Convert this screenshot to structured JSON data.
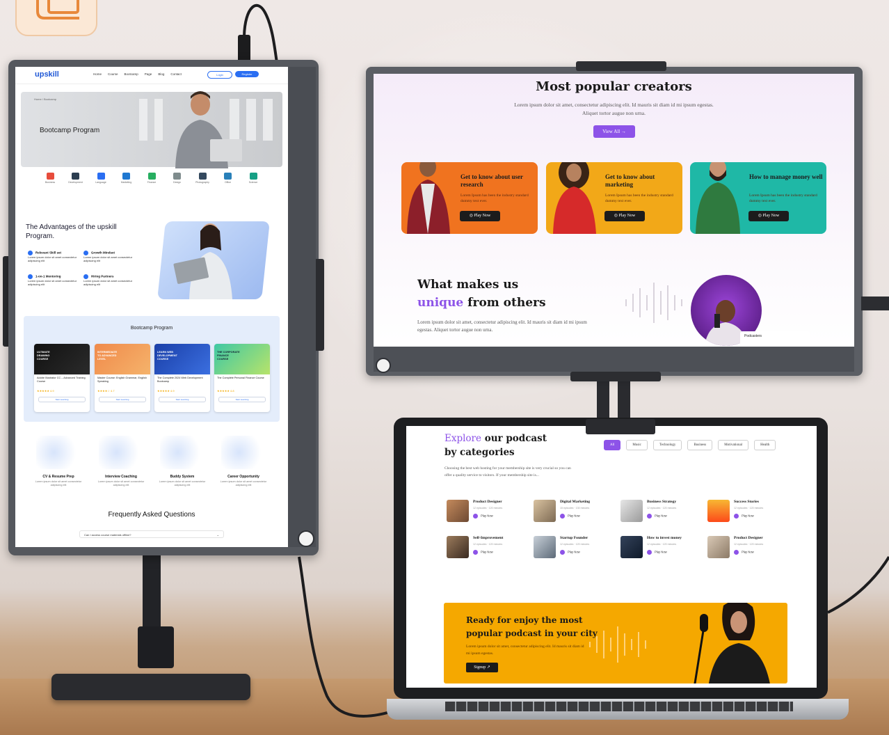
{
  "portrait": {
    "brand": "upskill",
    "nav": [
      "Home",
      "Course",
      "Bootcamp",
      "Page",
      "Blog",
      "Contact"
    ],
    "login": "Login",
    "register": "Register",
    "breadcrumb": "Home / Bootcamp",
    "hero_title": "Bootcamp Program",
    "categories": [
      "Business",
      "Development",
      "Language",
      "Marketing",
      "Finance",
      "Design",
      "Photography",
      "Office",
      "Science"
    ],
    "advantages_title": "The Advantages of the upskill Program.",
    "features": [
      {
        "title": "Relevant Skill set",
        "text": "Lorem ipsum dolor sit amet consectetur adipiscing elit"
      },
      {
        "title": "Growth Mindset",
        "text": "Lorem ipsum dolor sit amet consectetur adipiscing elit"
      },
      {
        "title": "1-on-1 Mentoring",
        "text": "Lorem ipsum dolor sit amet consectetur adipiscing elit"
      },
      {
        "title": "Hiring Partners",
        "text": "Lorem ipsum dolor sit amet consectetur adipiscing elit"
      }
    ],
    "bootcamp_title": "Bootcamp Program",
    "cards": [
      {
        "banner": "ULTIMATE DRAWING COURSE",
        "title": "Adobe Illustrator CC – Advanced Training Course",
        "rating": "★★★★★ 4.9",
        "cta": "Start Learning"
      },
      {
        "banner": "INTERMEDIATE TO ADVANCED LEVEL",
        "title": "Master Course: English Grammar, English Speaking",
        "rating": "★★★★☆ 4.7",
        "cta": "Start Learning"
      },
      {
        "banner": "LEARN WEB DEVELOPMENT COURSE",
        "title": "The Complete 2024 Web Development Bootcamp",
        "rating": "★★★★★ 4.9",
        "cta": "Start Learning"
      },
      {
        "banner": "THE CORPORATE FINANCE COURSE",
        "title": "The Complete Personal Finance Course",
        "rating": "★★★★★ 4.8",
        "cta": "Start Learning"
      }
    ],
    "services": [
      {
        "title": "CV & Resume Prep",
        "text": "Lorem ipsum dolor sit amet consectetur adipiscing elit"
      },
      {
        "title": "Interview Coaching",
        "text": "Lorem ipsum dolor sit amet consectetur adipiscing elit"
      },
      {
        "title": "Buddy System",
        "text": "Lorem ipsum dolor sit amet consectetur adipiscing elit"
      },
      {
        "title": "Career Opportunity",
        "text": "Lorem ipsum dolor sit amet consectetur adipiscing elit"
      }
    ],
    "faq_title": "Frequently Asked Questions",
    "faq_q1": "Can I access course materials offline?"
  },
  "landscape": {
    "title": "Most popular creators",
    "subtitle": "Lorem ipsum dolor sit amet, consectetur adipiscing elit. Id mauris sit diam id mi ipsum egestas. Aliquet tortor augue non urna.",
    "view_all": "View All →",
    "creators": [
      {
        "title": "Get to know about user research",
        "text": "Lorem Ipsum has been the industry standard dummy text ever.",
        "cta": "Play Now",
        "color": "#f0731f"
      },
      {
        "title": "Get to know about marketing",
        "text": "Lorem Ipsum has been the industry standard dummy text ever.",
        "cta": "Play Now",
        "color": "#f2a818"
      },
      {
        "title": "How to manage money well",
        "text": "Lorem Ipsum has been the industry standard dummy text ever.",
        "cta": "Play Now",
        "color": "#1fb8a6"
      }
    ],
    "what_1": "What makes us",
    "what_unique": "unique",
    "what_2": " from others",
    "what_text": "Lorem ipsum dolor sit amet, consectetur adipiscing elit. Id mauris sit diam id mi ipsum egestas. Aliquet tortor augue non urna.",
    "podcast_tag": "Podcasters"
  },
  "laptop": {
    "explore": "Explore",
    "title_rest": " our podcast",
    "title_line2": "by categories",
    "desc": "Choosing the best web hosting for your membership site is very crucial so you can offer a quality service to visitors. If your membership site is...",
    "chips": [
      "All",
      "Music",
      "Technology",
      "Business",
      "Motivational",
      "Health"
    ],
    "podcasts": [
      {
        "title": "Product Designer",
        "meta": "12 episodes · 120 minutes",
        "cta": "Play Now"
      },
      {
        "title": "Digital Marketing",
        "meta": "15 episodes · 130 minutes",
        "cta": "Play Now"
      },
      {
        "title": "Business Strategy",
        "meta": "12 episodes · 120 minutes",
        "cta": "Play Now"
      },
      {
        "title": "Success Stories",
        "meta": "12 episodes · 120 minutes",
        "cta": "Play Now"
      },
      {
        "title": "Self-Improvement",
        "meta": "12 episodes · 120 minutes",
        "cta": "Play Now"
      },
      {
        "title": "Startup Founder",
        "meta": "12 episodes · 120 minutes",
        "cta": "Play Now"
      },
      {
        "title": "How to invest money",
        "meta": "12 episodes · 120 minutes",
        "cta": "Play Now"
      },
      {
        "title": "Product Designer",
        "meta": "12 episodes · 120 minutes",
        "cta": "Play Now"
      }
    ],
    "banner_title_1": "Ready for enjoy the most",
    "banner_title_2": "popular podcast in your city",
    "banner_text": "Lorem ipsum dolor sit amet, consectetur adipiscing elit. Id mauris sit diam id mi ipsum egestas.",
    "signup": "Signup ↗"
  },
  "colors": {
    "accent": "#8d53e8",
    "brand_blue": "#2a6ef2",
    "banner": "#f5a800"
  }
}
